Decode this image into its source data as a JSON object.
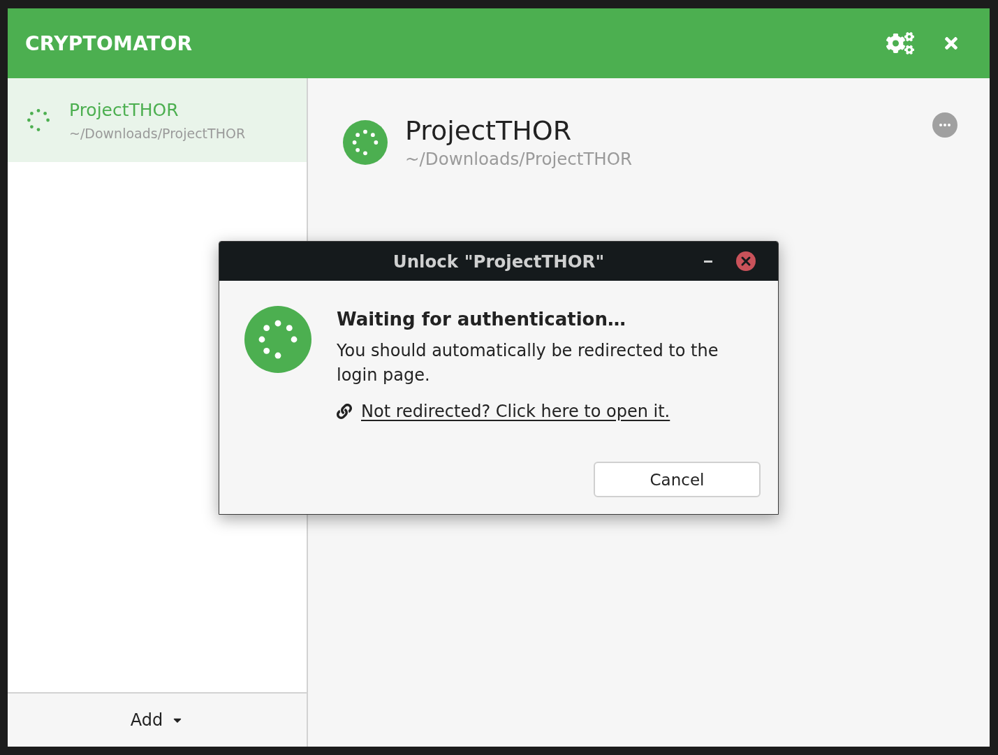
{
  "app": {
    "title": "CRYPTOMATOR"
  },
  "sidebar": {
    "vaults": [
      {
        "name": "ProjectTHOR",
        "path": "~/Downloads/ProjectTHOR",
        "selected": true
      }
    ],
    "add_button": {
      "label": "Add"
    }
  },
  "vault_detail": {
    "name": "ProjectTHOR",
    "path": "~/Downloads/ProjectTHOR"
  },
  "dialog": {
    "title": "Unlock \"ProjectTHOR\"",
    "heading": "Waiting for authentication…",
    "message": "You should automatically be redirected to the login page.",
    "link": "Not redirected? Click here to open it.",
    "buttons": [
      "Cancel"
    ]
  }
}
